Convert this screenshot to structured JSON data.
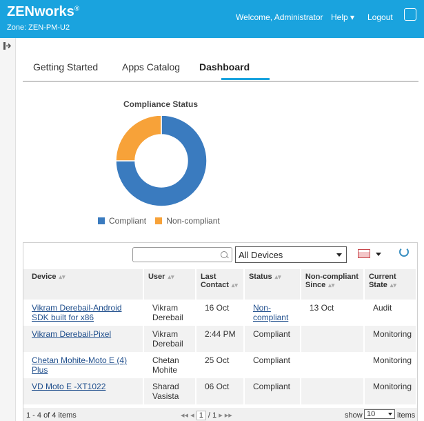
{
  "header": {
    "logo": "ZENworks",
    "logo_mark": "®",
    "zone": "Zone: ZEN-PM-U2",
    "welcome": "Welcome, Administrator",
    "help": "Help",
    "logout": "Logout"
  },
  "tabs": [
    "Getting Started",
    "Apps Catalog",
    "Dashboard"
  ],
  "active_tab": "Dashboard",
  "chart_data": {
    "type": "pie",
    "title": "Compliance Status",
    "categories": [
      "Compliant",
      "Non-compliant"
    ],
    "values": [
      3,
      1
    ],
    "colors": [
      "#3a7bbf",
      "#f7a239"
    ],
    "legend_position": "bottom"
  },
  "grid": {
    "search_placeholder": "",
    "device_filter": "All Devices",
    "columns": [
      "Device",
      "User",
      "Last Contact",
      "Status",
      "Non-compliant Since",
      "Current State"
    ],
    "rows": [
      {
        "device": "Vikram Derebail-Android SDK built for x86",
        "user": "Vikram Derebail",
        "last_contact": "16 Oct",
        "status": "Non-compliant",
        "since": "13 Oct",
        "state": "Audit"
      },
      {
        "device": "Vikram Derebail-Pixel",
        "user": "Vikram Derebail",
        "last_contact": "2:44 PM",
        "status": "Compliant",
        "since": "",
        "state": "Monitoring"
      },
      {
        "device": "Chetan Mohite-Moto E (4) Plus",
        "user": "Chetan Mohite",
        "last_contact": "25 Oct",
        "status": "Compliant",
        "since": "",
        "state": "Monitoring"
      },
      {
        "device": "VD Moto E -XT1022",
        "user": "Sharad Vasista",
        "last_contact": "06 Oct",
        "status": "Compliant",
        "since": "",
        "state": "Monitoring"
      }
    ],
    "footer": {
      "count": "1 - 4 of 4 items",
      "page": "1",
      "page_total": "/ 1",
      "show": "show",
      "page_size": "10",
      "items": "items"
    }
  }
}
